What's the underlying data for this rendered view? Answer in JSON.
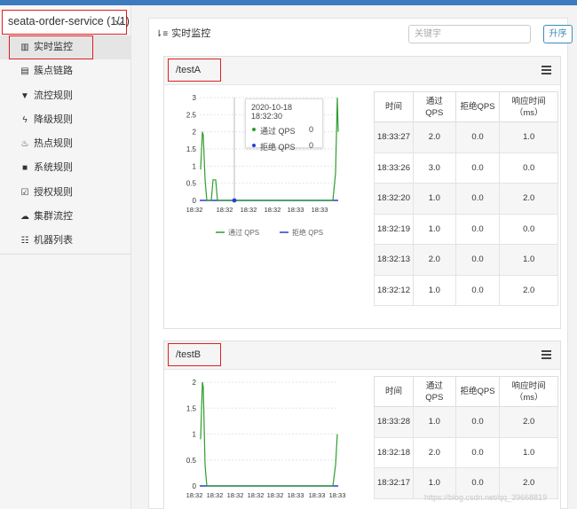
{
  "app": {
    "selected": "seata-order-service (1/1)"
  },
  "sidebar": {
    "items": [
      {
        "label": "实时监控",
        "icon": "bar-chart-icon",
        "glyph": "▥"
      },
      {
        "label": "簇点链路",
        "icon": "list-icon",
        "glyph": "▤"
      },
      {
        "label": "流控规则",
        "icon": "filter-icon",
        "glyph": "▼"
      },
      {
        "label": "降级规则",
        "icon": "bolt-icon",
        "glyph": "ϟ"
      },
      {
        "label": "热点规则",
        "icon": "fire-icon",
        "glyph": "♨"
      },
      {
        "label": "系统规则",
        "icon": "lock-icon",
        "glyph": "■"
      },
      {
        "label": "授权规则",
        "icon": "check-square-icon",
        "glyph": "☑"
      },
      {
        "label": "集群流控",
        "icon": "cloud-icon",
        "glyph": "☁"
      },
      {
        "label": "机器列表",
        "icon": "th-list-icon",
        "glyph": "☷"
      }
    ]
  },
  "main": {
    "title": "实时监控",
    "search_placeholder": "关键字",
    "sort_label": "升序"
  },
  "colors": {
    "pass": "#2e9e2e",
    "block": "#2b3bd6",
    "accent": "#3c8dbc"
  },
  "panels": [
    {
      "resource": "/testA",
      "tooltip": {
        "time": "2020-10-18 18:32:30",
        "pass_label": "通过 QPS",
        "pass_value": "0",
        "block_label": "拒绝 QPS",
        "block_value": "0"
      },
      "chart_data": {
        "type": "line",
        "x": [
          "18:32",
          "18:32",
          "18:32",
          "18:32",
          "18:33",
          "18:33"
        ],
        "ylim": [
          0,
          3
        ],
        "y_ticks": [
          "0",
          "0.5",
          "1",
          "1.5",
          "2",
          "2.5",
          "3"
        ],
        "legend": [
          "通过 QPS",
          "拒绝 QPS"
        ],
        "legend_position": "bottom"
      },
      "table": {
        "headers": [
          "时间",
          "通过 QPS",
          "拒绝QPS",
          "响应时间（ms）"
        ],
        "rows": [
          [
            "18:33:27",
            "2.0",
            "0.0",
            "1.0"
          ],
          [
            "18:33:26",
            "3.0",
            "0.0",
            "0.0"
          ],
          [
            "18:32:20",
            "1.0",
            "0.0",
            "2.0"
          ],
          [
            "18:32:19",
            "1.0",
            "0.0",
            "0.0"
          ],
          [
            "18:32:13",
            "2.0",
            "0.0",
            "1.0"
          ],
          [
            "18:32:12",
            "1.0",
            "0.0",
            "2.0"
          ]
        ]
      }
    },
    {
      "resource": "/testB",
      "chart_data": {
        "type": "line",
        "x": [
          "18:32",
          "18:32",
          "18:32",
          "18:32",
          "18:32",
          "18:33",
          "18:33",
          "18:33"
        ],
        "ylim": [
          0,
          2
        ],
        "y_ticks": [
          "0",
          "0.5",
          "1",
          "1.5",
          "2"
        ]
      },
      "table": {
        "headers": [
          "时间",
          "通过 QPS",
          "拒绝QPS",
          "响应时间（ms）"
        ],
        "rows": [
          [
            "18:33:28",
            "1.0",
            "0.0",
            "2.0"
          ],
          [
            "18:32:18",
            "2.0",
            "0.0",
            "1.0"
          ],
          [
            "18:32:17",
            "1.0",
            "0.0",
            "2.0"
          ]
        ]
      }
    }
  ],
  "watermark": "https://blog.csdn.net/qq_39668819"
}
